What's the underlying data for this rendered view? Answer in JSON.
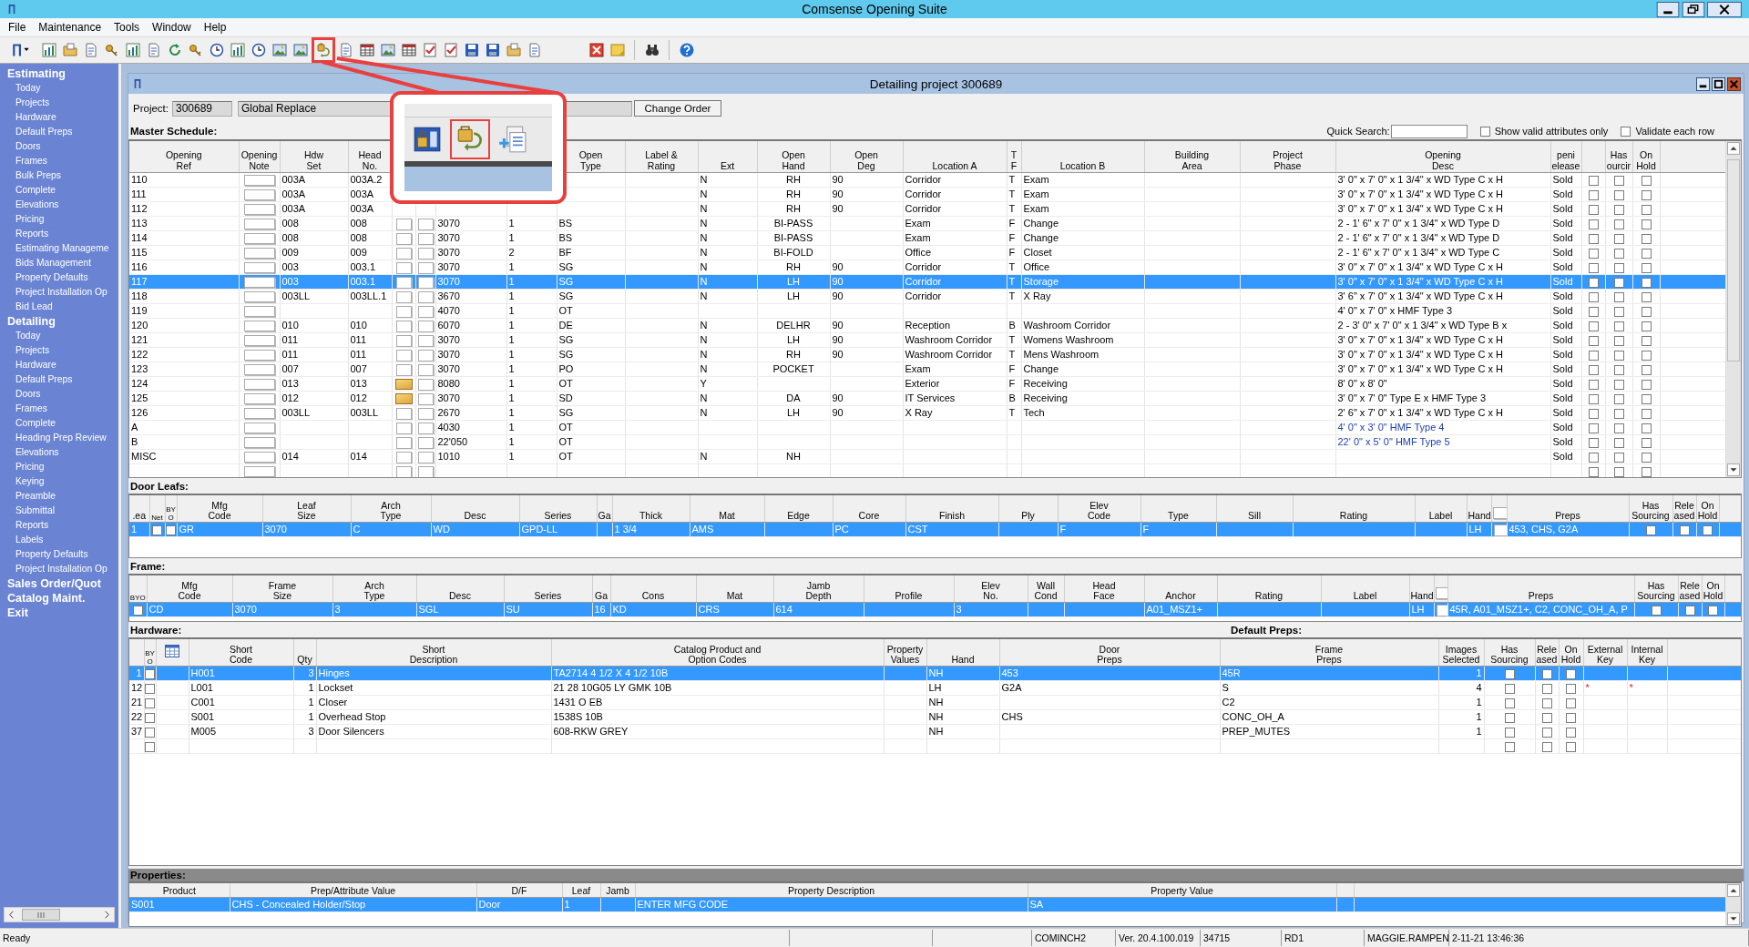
{
  "window": {
    "title": "Comsense Opening Suite"
  },
  "menu": [
    "File",
    "Maintenance",
    "Tools",
    "Window",
    "Help"
  ],
  "sidebar": {
    "sections": [
      {
        "label": "Estimating",
        "items": [
          "Today",
          "Projects",
          "Hardware",
          "Default Preps",
          "Doors",
          "Frames",
          "Bulk Preps",
          "Complete",
          "Elevations",
          "Pricing",
          "Reports",
          "Estimating Manageme",
          "Bids Management",
          "Property Defaults",
          "Project Installation Op",
          "Bid Lead"
        ]
      },
      {
        "label": "Detailing",
        "items": [
          "Today",
          "Projects",
          "Hardware",
          "Default Preps",
          "Doors",
          "Frames",
          "Complete",
          "Heading Prep Review",
          "Elevations",
          "Pricing",
          "Keying",
          "Preamble",
          "Submittal",
          "Reports",
          "Labels",
          "Property Defaults",
          "Project Installation Op"
        ]
      },
      {
        "label": "Sales Order/Quot"
      },
      {
        "label": "Catalog Maint."
      },
      {
        "label": "Exit"
      }
    ]
  },
  "document": {
    "title": "Detailing project 300689",
    "project_label": "Project:",
    "project_number": "300689",
    "project_name": "Global Replace",
    "change_order": "Change Order"
  },
  "quick_search": {
    "label": "Quick Search:",
    "options": [
      {
        "label": "Show valid attributes only",
        "checked": false
      },
      {
        "label": "Validate each row",
        "checked": false
      }
    ]
  },
  "master": {
    "title": "Master Schedule:",
    "headers": {
      "ref": "Opening\nRef",
      "note": "Opening\nNote",
      "hdw": "Hdw\nSet",
      "head": "Head\nNo.",
      "type": "Open\nType",
      "label": "Label &\nRating",
      "ext": "Ext",
      "hand": "Open\nHand",
      "deg": "Open\nDeg",
      "loc_a": "Location A",
      "tf": "T\nF",
      "loc_b": "Location B",
      "area": "Building\nArea",
      "phase": "Project\nPhase",
      "desc": "Opening\nDesc",
      "sold": "peni\nelease",
      "sourcing": "Has\nourcir",
      "on_hold": "On\nHold"
    },
    "rows": [
      {
        "ref": "110",
        "hdw": "003A",
        "head": "003A.2",
        "ext": "N",
        "hand": "RH",
        "deg": "90",
        "loc_a": "Corridor",
        "tf": "T",
        "loc_b": "Exam",
        "desc": "3' 0\" x 7' 0\" x 1 3/4\" x WD Type C x H",
        "sold": "Sold",
        "custom": false,
        "released": false,
        "sourcing": false,
        "on_hold": false,
        "selected": false
      },
      {
        "ref": "111",
        "hdw": "003A",
        "head": "003A",
        "ext": "N",
        "hand": "RH",
        "deg": "90",
        "loc_a": "Corridor",
        "tf": "T",
        "loc_b": "Exam",
        "desc": "3' 0\" x 7' 0\" x 1 3/4\" x WD Type C x H",
        "sold": "Sold",
        "custom": false,
        "released": false,
        "sourcing": false,
        "on_hold": false,
        "selected": false
      },
      {
        "ref": "112",
        "hdw": "003A",
        "head": "003A",
        "ext": "N",
        "hand": "RH",
        "deg": "90",
        "loc_a": "Corridor",
        "tf": "T",
        "loc_b": "Exam",
        "desc": "3' 0\" x 7' 0\" x 1 3/4\" x WD Type C x H",
        "sold": "Sold",
        "custom": false,
        "released": false,
        "sourcing": false,
        "on_hold": false,
        "selected": false
      },
      {
        "ref": "113",
        "hdw": "008",
        "head": "008",
        "note": false,
        "size": "3070",
        "qty": "1",
        "type": "BS",
        "ext": "N",
        "hand": "BI-PASS",
        "loc_a": "Exam",
        "tf": "F",
        "loc_b": "Change",
        "desc": "2 - 1' 6\" x 7' 0\" x 1 3/4\" x WD Type D",
        "sold": "Sold",
        "custom": false,
        "released": false,
        "sourcing": false,
        "on_hold": false,
        "selected": false
      },
      {
        "ref": "114",
        "hdw": "008",
        "head": "008",
        "note": false,
        "size": "3070",
        "qty": "1",
        "type": "BS",
        "ext": "N",
        "hand": "BI-PASS",
        "loc_a": "Exam",
        "tf": "F",
        "loc_b": "Change",
        "desc": "2 - 1' 6\" x 7' 0\" x 1 3/4\" x WD Type D",
        "sold": "Sold",
        "custom": false,
        "released": false,
        "sourcing": false,
        "on_hold": false,
        "selected": false
      },
      {
        "ref": "115",
        "hdw": "009",
        "head": "009",
        "note": false,
        "size": "3070",
        "qty": "2",
        "type": "BF",
        "ext": "N",
        "hand": "BI-FOLD",
        "loc_a": "Office",
        "tf": "F",
        "loc_b": "Closet",
        "desc": "2 - 1' 6\" x 7' 0\" x 1 3/4\" x WD Type C",
        "sold": "Sold",
        "custom": false,
        "released": false,
        "sourcing": false,
        "on_hold": false,
        "selected": false
      },
      {
        "ref": "116",
        "hdw": "003",
        "head": "003.1",
        "note": false,
        "size": "3070",
        "qty": "1",
        "type": "SG",
        "ext": "N",
        "hand": "RH",
        "deg": "90",
        "loc_a": "Corridor",
        "tf": "T",
        "loc_b": "Office",
        "desc": "3' 0\" x 7' 0\" x 1 3/4\" x WD Type C x H",
        "sold": "Sold",
        "custom": false,
        "released": false,
        "sourcing": false,
        "on_hold": false,
        "selected": false
      },
      {
        "ref": "117",
        "hdw": "003",
        "head": "003.1",
        "note": false,
        "size": "3070",
        "qty": "1",
        "type": "SG",
        "ext": "N",
        "hand": "LH",
        "deg": "90",
        "loc_a": "Corridor",
        "tf": "T",
        "loc_b": "Storage",
        "desc": "3' 0\" x 7' 0\" x 1 3/4\" x WD Type C x H",
        "sold": "Sold",
        "custom": false,
        "released": false,
        "sourcing": false,
        "on_hold": false,
        "selected": true
      },
      {
        "ref": "118",
        "hdw": "003LL",
        "head": "003LL.1",
        "note": false,
        "size": "3670",
        "qty": "1",
        "type": "SG",
        "ext": "N",
        "hand": "LH",
        "deg": "90",
        "loc_a": "Corridor",
        "tf": "T",
        "loc_b": "X Ray",
        "desc": "3' 6\" x 7' 0\" x 1 3/4\" x WD Type C x H",
        "sold": "Sold",
        "custom": false,
        "released": false,
        "sourcing": false,
        "on_hold": false,
        "selected": false
      },
      {
        "ref": "119",
        "note": false,
        "size": "4070",
        "qty": "1",
        "type": "OT",
        "desc": "4' 0\" x 7' 0\" x HMF Type 3",
        "sold": "Sold",
        "custom": false,
        "released": false,
        "sourcing": false,
        "on_hold": false,
        "selected": false
      },
      {
        "ref": "120",
        "hdw": "010",
        "head": "010",
        "note": false,
        "size": "6070",
        "qty": "1",
        "type": "DE",
        "ext": "N",
        "hand": "DELHR",
        "deg": "90",
        "loc_a": "Reception",
        "tf": "B",
        "loc_b": "Washroom Corridor",
        "desc": "2 - 3' 0\" x 7' 0\" x 1 3/4\" x WD Type B x",
        "sold": "Sold",
        "custom": false,
        "released": false,
        "sourcing": false,
        "on_hold": false,
        "selected": false
      },
      {
        "ref": "121",
        "hdw": "011",
        "head": "011",
        "note": false,
        "size": "3070",
        "qty": "1",
        "type": "SG",
        "ext": "N",
        "hand": "LH",
        "deg": "90",
        "loc_a": "Washroom Corridor",
        "tf": "T",
        "loc_b": "Womens Washroom",
        "desc": "3' 0\" x 7' 0\" x 1 3/4\" x WD Type C x H",
        "sold": "Sold",
        "custom": false,
        "released": false,
        "sourcing": false,
        "on_hold": false,
        "selected": false
      },
      {
        "ref": "122",
        "hdw": "011",
        "head": "011",
        "note": false,
        "size": "3070",
        "qty": "1",
        "type": "SG",
        "ext": "N",
        "hand": "RH",
        "deg": "90",
        "loc_a": "Washroom Corridor",
        "tf": "T",
        "loc_b": "Mens Washroom",
        "desc": "3' 0\" x 7' 0\" x 1 3/4\" x WD Type C x H",
        "sold": "Sold",
        "custom": false,
        "released": false,
        "sourcing": false,
        "on_hold": false,
        "selected": false
      },
      {
        "ref": "123",
        "hdw": "007",
        "head": "007",
        "note": false,
        "size": "3070",
        "qty": "1",
        "type": "PO",
        "ext": "N",
        "hand": "POCKET",
        "loc_a": "Exam",
        "tf": "F",
        "loc_b": "Change",
        "desc": "3' 0\" x 7' 0\" x 1 3/4\" x WD Type C x H",
        "sold": "Sold",
        "custom": false,
        "released": false,
        "sourcing": false,
        "on_hold": false,
        "selected": false
      },
      {
        "ref": "124",
        "hdw": "013",
        "head": "013",
        "note": true,
        "size": "8080",
        "qty": "1",
        "type": "OT",
        "ext": "Y",
        "loc_a": "Exterior",
        "tf": "F",
        "loc_b": "Receiving",
        "desc": "8' 0\" x 8' 0\"",
        "sold": "Sold",
        "custom": false,
        "released": false,
        "sourcing": false,
        "on_hold": false,
        "selected": false
      },
      {
        "ref": "125",
        "hdw": "012",
        "head": "012",
        "note": true,
        "size": "3070",
        "qty": "1",
        "type": "SD",
        "ext": "N",
        "hand": "DA",
        "deg": "90",
        "loc_a": "IT Services",
        "tf": "B",
        "loc_b": "Receiving",
        "desc": "3' 0\" x 7' 0\"  Type E x HMF Type 3",
        "sold": "Sold",
        "custom": false,
        "released": false,
        "sourcing": false,
        "on_hold": false,
        "selected": false
      },
      {
        "ref": "126",
        "hdw": "003LL",
        "head": "003LL",
        "note": false,
        "size": "2670",
        "qty": "1",
        "type": "SG",
        "ext": "N",
        "hand": "LH",
        "deg": "90",
        "loc_a": "X Ray",
        "tf": "T",
        "loc_b": "Tech",
        "desc": "2' 6\" x 7' 0\" x 1 3/4\" x WD Type C x H",
        "sold": "Sold",
        "custom": false,
        "released": false,
        "sourcing": false,
        "on_hold": false,
        "selected": false
      },
      {
        "ref": "A",
        "note": false,
        "size": "4030",
        "qty": "1",
        "type": "OT",
        "desc": "4' 0\" x 3' 0\"  HMF Type 4",
        "sold": "Sold",
        "custom": true,
        "released": false,
        "sourcing": false,
        "on_hold": false,
        "selected": false
      },
      {
        "ref": "B",
        "note": false,
        "size": "22'050",
        "qty": "1",
        "type": "OT",
        "desc": "22' 0\" x 5' 0\" HMF Type 5",
        "sold": "Sold",
        "custom": true,
        "released": false,
        "sourcing": false,
        "on_hold": false,
        "selected": false
      },
      {
        "ref": "MISC",
        "hdw": "014",
        "head": "014",
        "note": false,
        "size": "1010",
        "qty": "1",
        "type": "OT",
        "ext": "N",
        "hand": "NH",
        "sold": "Sold",
        "released": false,
        "sourcing": false,
        "on_hold": false,
        "selected": false
      },
      {
        "note": false,
        "released": false,
        "sourcing": false,
        "on_hold": false,
        "selected": false
      }
    ]
  },
  "door_leafs": {
    "title": "Door Leafs:",
    "headers": {
      "ea": ".ea",
      "net": "Net",
      "byo": "BYO",
      "mfg": "Mfg\nCode",
      "size": "Leaf\nSize",
      "arch": "Arch\nType",
      "desc": "Desc",
      "series": "Series",
      "ga": "Ga",
      "thick": "Thick",
      "mat": "Mat",
      "edge": "Edge",
      "core": "Core",
      "finish": "Finish",
      "ply": "Ply",
      "elev": "Elev\nCode",
      "type": "Type",
      "sill": "Sill",
      "rating": "Rating",
      "label": "Label",
      "hand": "Hand",
      "preps": "Preps",
      "sourcing": "Has\nSourcing",
      "released": "Rele\nased",
      "on_hold": "On\nHold"
    },
    "rows": [
      {
        "ea": "1",
        "net": false,
        "byo": false,
        "mfg": "GR",
        "size": "3070",
        "arch": "C",
        "desc": "WD",
        "series": "GPD-LL",
        "thick": "1 3/4",
        "mat": "AMS",
        "core": "PC",
        "finish": "CST",
        "elev": "F",
        "type": "F",
        "hand": "LH",
        "preps": "453, CHS, G2A",
        "sourcing": false,
        "released": false,
        "on_hold": false,
        "selected": true
      }
    ]
  },
  "frame": {
    "title": "Frame:",
    "headers": {
      "byo": "BYO",
      "mfg": "Mfg\nCode",
      "size": "Frame\nSize",
      "arch": "Arch\nType",
      "desc": "Desc",
      "series": "Series",
      "ga": "Ga",
      "cons": "Cons",
      "mat": "Mat",
      "jamb": "Jamb\nDepth",
      "profile": "Profile",
      "elev": "Elev\nNo.",
      "wall": "Wall\nCond",
      "head": "Head\nFace",
      "anchor": "Anchor",
      "rating": "Rating",
      "label": "Label",
      "hand": "Hand",
      "preps": "Preps",
      "sourcing": "Has\nSourcing",
      "released": "Rele\nased",
      "on_hold": "On\nHold"
    },
    "rows": [
      {
        "byo": false,
        "mfg": "CD",
        "size": "3070",
        "arch": "3",
        "desc": "SGL",
        "series": "SU",
        "ga": "16",
        "cons": "KD",
        "mat": "CRS",
        "jamb": "614",
        "elev": "3",
        "anchor": "A01_MSZ1+",
        "hand": "LH",
        "preps": "45R, A01_MSZ1+, C2, CONC_OH_A, P",
        "sourcing": false,
        "released": false,
        "on_hold": false,
        "selected": true
      }
    ]
  },
  "hardware": {
    "title": "Hardware:",
    "default_preps": "Default Preps:",
    "headers": {
      "byo": "BYO",
      "code": "Short\nCode",
      "qty": "Qty",
      "desc": "Short\nDescription",
      "catalog": "Catalog Product and\nOption Codes",
      "prop": "Property\nValues",
      "hand": "Hand",
      "door": "Door\nPreps",
      "frame": "Frame\nPreps",
      "images": "Images\nSelected",
      "sourcing": "Has\nSourcing",
      "released": "Rele\nased",
      "on_hold": "On\nHold",
      "ext_key": "External\nKey",
      "int_key": "Internal\nKey"
    },
    "rows": [
      {
        "num": "1",
        "byo": false,
        "code": "H001",
        "qty": "3",
        "desc": "Hinges",
        "catalog": "TA2714 4 1/2 X 4 1/2 10B",
        "hand": "NH",
        "door": "453",
        "frame": "45R",
        "images": "1",
        "sourcing": false,
        "released": false,
        "on_hold": false,
        "selected": true
      },
      {
        "num": "12",
        "byo": false,
        "code": "L001",
        "qty": "1",
        "desc": "Lockset",
        "catalog": "21 28 10G05 LY GMK 10B",
        "hand": "LH",
        "door": "G2A",
        "frame": "S",
        "images": "4",
        "sourcing": false,
        "released": false,
        "on_hold": false,
        "ext_key": "*",
        "int_key": "*",
        "selected": false
      },
      {
        "num": "21",
        "byo": false,
        "code": "C001",
        "qty": "1",
        "desc": "Closer",
        "catalog": "1431 O EB",
        "hand": "NH",
        "frame": "C2",
        "images": "1",
        "sourcing": false,
        "released": false,
        "on_hold": false,
        "selected": false
      },
      {
        "num": "22",
        "byo": false,
        "code": "S001",
        "qty": "1",
        "desc": "Overhead Stop",
        "catalog": "1538S 10B",
        "hand": "NH",
        "door": "CHS",
        "frame": "CONC_OH_A",
        "images": "1",
        "sourcing": false,
        "released": false,
        "on_hold": false,
        "selected": false
      },
      {
        "num": "37",
        "byo": false,
        "code": "M005",
        "qty": "3",
        "desc": "Door Silencers",
        "catalog": "608-RKW GREY",
        "hand": "NH",
        "frame": "PREP_MUTES",
        "images": "1",
        "sourcing": false,
        "released": false,
        "on_hold": false,
        "selected": false
      },
      {
        "byo": false,
        "sourcing": false,
        "released": false,
        "on_hold": false,
        "selected": false
      }
    ]
  },
  "properties": {
    "title": "Properties:",
    "headers": {
      "product": "Product",
      "prep": "Prep/Attribute Value",
      "df": "D/F",
      "leaf": "Leaf",
      "jamb": "Jamb",
      "pdesc": "Property Description",
      "pval": "Property Value"
    },
    "rows": [
      {
        "product": "S001",
        "prep": "CHS - Concealed Holder/Stop",
        "df": "Door",
        "leaf": "1",
        "pdesc": "ENTER MFG CODE",
        "pval": "SA",
        "selected": true
      }
    ]
  },
  "status_bar": [
    "Ready",
    "COMINCH2",
    "Ver. 20.4.100.019",
    "34715",
    "RD1",
    "MAGGIE.RAMPEN",
    "2-11-21 13:46:36"
  ]
}
